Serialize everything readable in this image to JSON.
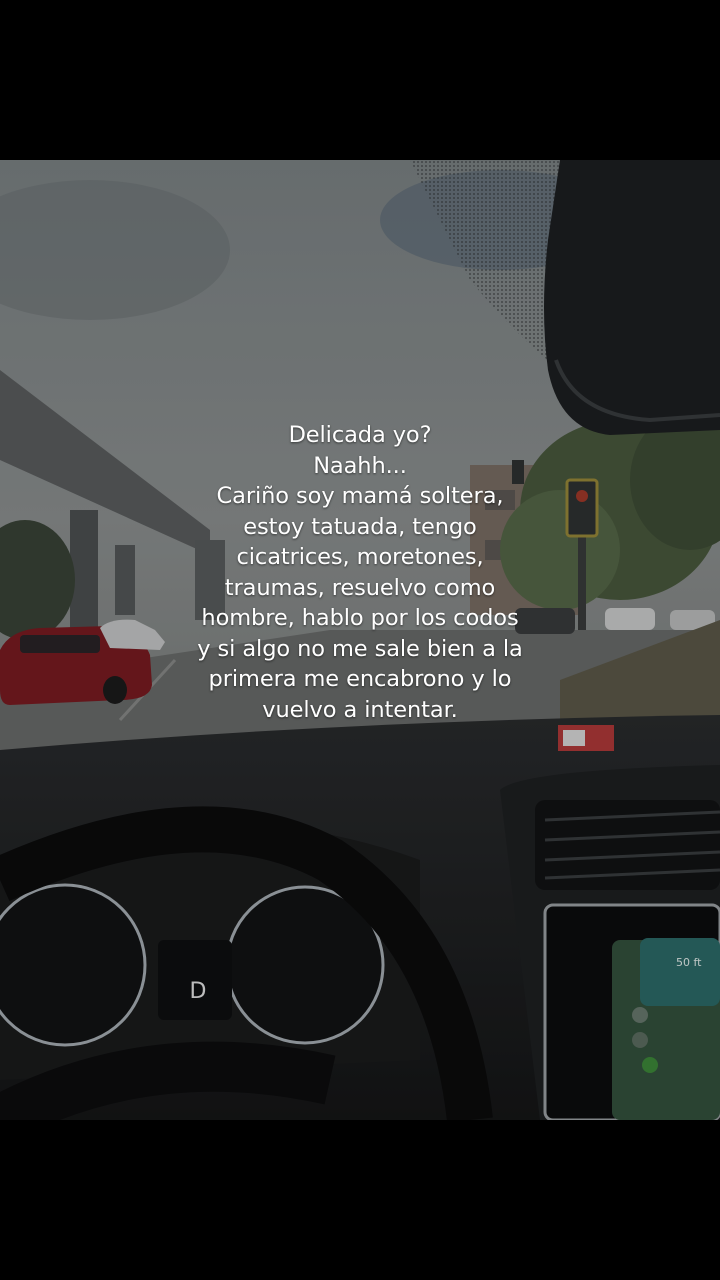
{
  "caption": {
    "lines": [
      "Delicada yo?",
      "Naahh...",
      "Cariño soy mamá soltera,",
      "estoy tatuada, tengo",
      "cicatrices, moretones,",
      "traumas, resuelvo como",
      "hombre, hablo por los codos",
      "y si algo no me sale bien a la",
      "primera me encabrono y lo",
      "vuelvo a intentar."
    ]
  },
  "dashboard": {
    "gear": "D",
    "nav_distance": "50 ft"
  }
}
